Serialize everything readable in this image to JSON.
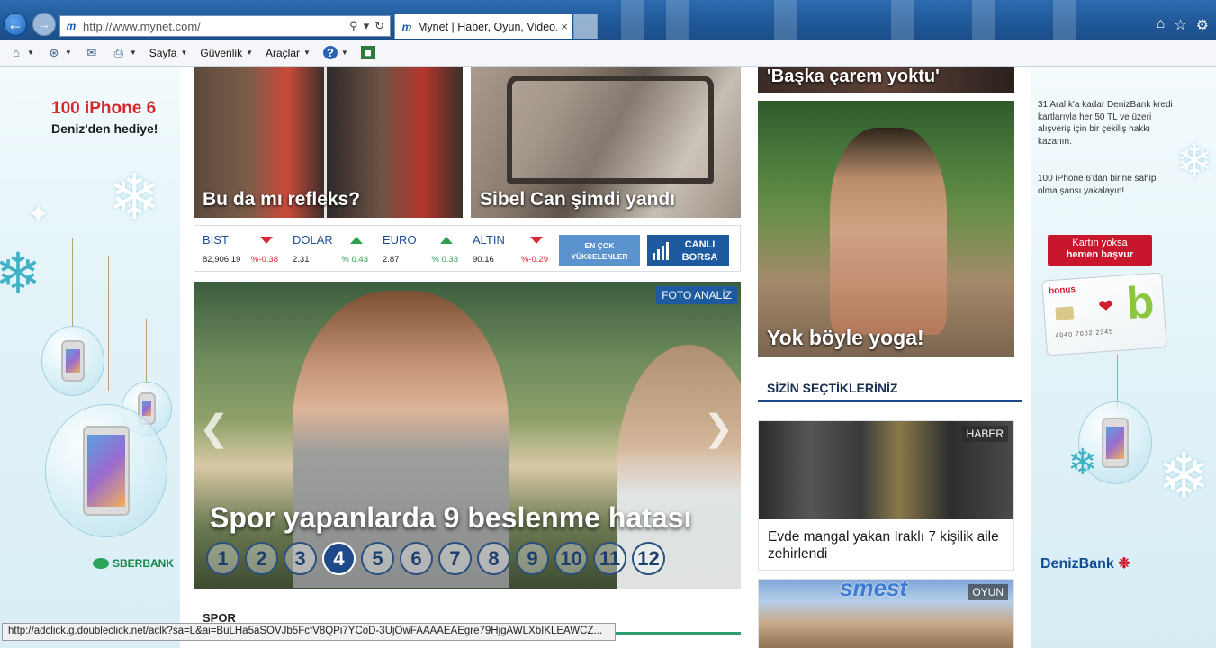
{
  "browser": {
    "url": "http://www.mynet.com/",
    "tab_title": "Mynet | Haber, Oyun, Video...",
    "favicon_glyph": "m",
    "tab_close": "×",
    "command_bar": {
      "page_label": "Sayfa",
      "safety_label": "Güvenlik",
      "tools_label": "Araçlar"
    },
    "status_text": "http://adclick.g.doubleclick.net/aclk?sa=L&ai=BuLHa5aSOVJb5FcfV8QPi7YCoD-3UjOwFAAAAEAEgre79HjgAWLXbIKLEAWCZ..."
  },
  "ad_left": {
    "headline": "100 iPhone 6",
    "subline": "Deniz'den hediye!",
    "brand": "SBERBANK"
  },
  "ad_right": {
    "text1": "31 Aralık'a kadar DenizBank kredi kartlarıyla her 50 TL ve üzeri alışveriş için bir çekiliş hakkı kazanın.",
    "text2": "100 iPhone 6'dan birine sahip olma şansı yakalayın!",
    "apply_line1": "Kartın yoksa",
    "apply_line2": "hemen başvur",
    "card_brand": "bonus",
    "card_letter": "b",
    "card_number": "4040  7002 2345",
    "brand": "DenizBank"
  },
  "stories": {
    "refleks": "Bu da mı refleks?",
    "sibel": "Sibel Can şimdi yandı",
    "baska": "'Başka çarem yoktu'",
    "yoga": "Yok böyle yoga!"
  },
  "market": {
    "items": [
      {
        "name": "BIST",
        "value": "82,906.19",
        "change": "%-0.38",
        "dir": "down"
      },
      {
        "name": "DOLAR",
        "value": "2.31",
        "change": "% 0.43",
        "dir": "up"
      },
      {
        "name": "EURO",
        "value": "2.87",
        "change": "% 0.33",
        "dir": "up"
      },
      {
        "name": "ALTIN",
        "value": "90.16",
        "change": "%-0.29",
        "dir": "down"
      }
    ],
    "top_risers_line1": "EN ÇOK",
    "top_risers_line2": "YÜKSELENLER",
    "live_line1": "CANLI",
    "live_line2": "BORSA"
  },
  "hero": {
    "tag": "FOTO ANALİZ",
    "title": "Spor yapanlarda 9 beslenme hatası",
    "prev": "❮",
    "next": "❯",
    "pages": [
      "1",
      "2",
      "3",
      "4",
      "5",
      "6",
      "7",
      "8",
      "9",
      "10",
      "11",
      "12"
    ],
    "active_page": 4
  },
  "section_spor": "SPOR",
  "right_column": {
    "section_title": "SİZİN SEÇTİKLERİNİZ",
    "news": [
      {
        "tag": "HABER",
        "text": "Evde mangal yakan Iraklı 7 kişilik aile zehirlendi"
      },
      {
        "tag": "OYUN",
        "logo": "smest"
      }
    ]
  },
  "colors": {
    "accent_blue": "#1e5aa0",
    "up_green": "#2e9e4f",
    "down_red": "#d8282f"
  }
}
